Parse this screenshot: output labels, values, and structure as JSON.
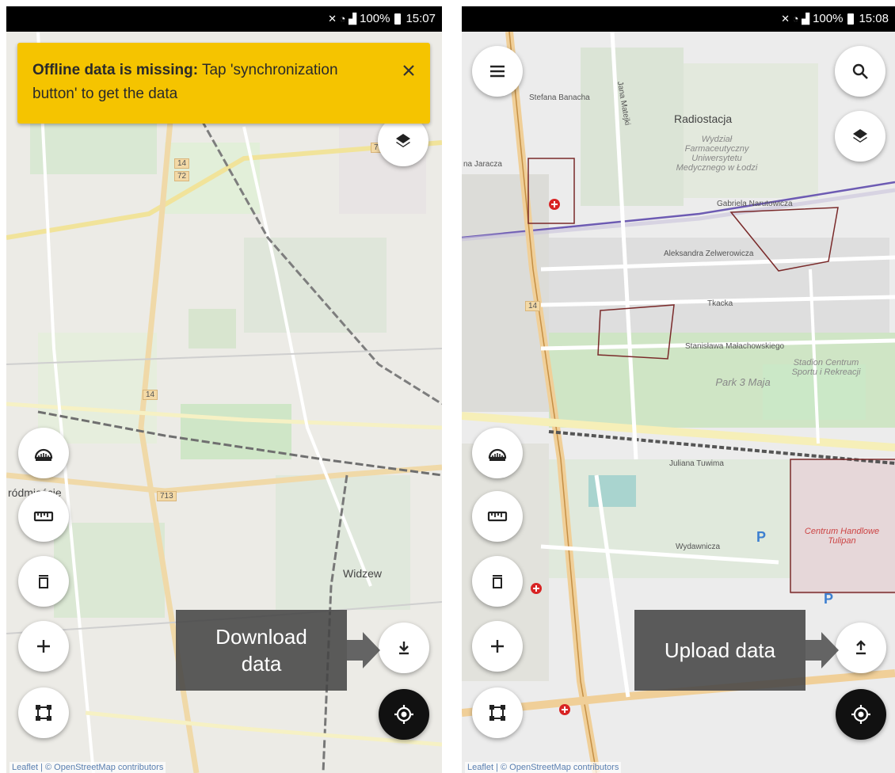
{
  "screens": [
    {
      "status": {
        "time": "15:07",
        "battery": "100%"
      },
      "banner": {
        "bold": "Offline data is missing:",
        "text": "Tap 'synchronization button' to get the data"
      },
      "map_labels": {
        "district": "ródmieście",
        "widzew": "Widzew",
        "road_14a": "14",
        "road_72": "72",
        "road_14b": "14",
        "road_14c": "14",
        "road_713": "713",
        "road_7": "7"
      },
      "callout": "Download\ndata",
      "attribution": "Leaflet | © OpenStreetMap contributors"
    },
    {
      "status": {
        "time": "15:08",
        "battery": "100%"
      },
      "map_labels": {
        "stefana": "Stefana Banacha",
        "matejki": "Jana Matejki",
        "radiostacja": "Radiostacja",
        "wydzial": "Wydział Farmaceutyczny Uniwersytetu Medycznego w Łodzi",
        "jaracza": "na Jaracza",
        "narutowicza": "Gabriela Narutowicza",
        "zelwerowicza": "Aleksandra Zelwerowicza",
        "tkacka": "Tkacka",
        "malachowskiego": "Stanisława Małachowskiego",
        "park": "Park 3 Maja",
        "stadion": "Stadion Centrum Sportu i Rekreacji",
        "tuwima": "Juliana Tuwima",
        "centrum": "Centrum Handlowe Tulipan",
        "wydawnicza": "Wydawnicza",
        "road14": "14",
        "parking": "P",
        "parking2": "P"
      },
      "callout": "Upload data",
      "attribution": "Leaflet | © OpenStreetMap contributors"
    }
  ],
  "colors": {
    "banner": "#f5c400",
    "callout": "#464646",
    "fab": "#ffffff",
    "locate_fab": "#111111"
  },
  "icons": [
    "layers-icon",
    "menu-icon",
    "search-icon",
    "ruler-icon",
    "measure-icon",
    "delete-icon",
    "add-icon",
    "polygon-icon",
    "download-icon",
    "upload-icon",
    "locate-icon",
    "close-icon"
  ]
}
